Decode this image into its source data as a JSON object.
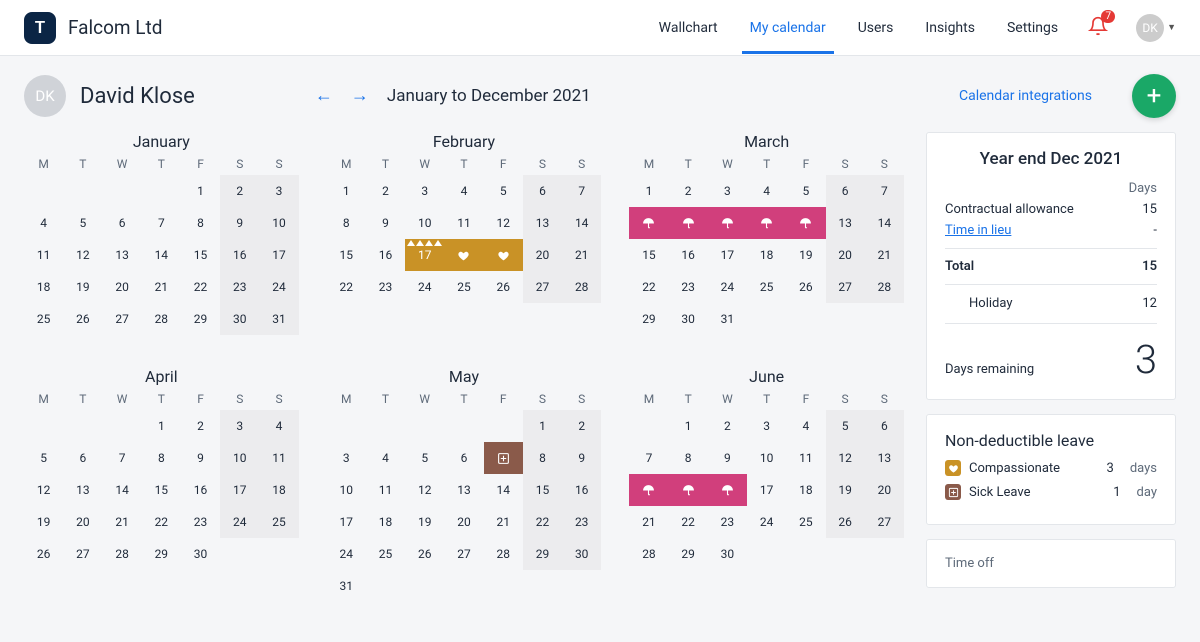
{
  "brand": {
    "logo_letter": "T",
    "name": "Falcom Ltd"
  },
  "nav": {
    "items": [
      "Wallchart",
      "My calendar",
      "Users",
      "Insights",
      "Settings"
    ],
    "active_index": 1,
    "notifications": "7",
    "user_initials": "DK"
  },
  "page": {
    "user_initials": "DK",
    "user_name": "David Klose",
    "period": "January to December 2021",
    "calendar_integrations": "Calendar integrations"
  },
  "dow": [
    "M",
    "T",
    "W",
    "T",
    "F",
    "S",
    "S"
  ],
  "side": {
    "title": "Year end Dec 2021",
    "days_label": "Days",
    "contractual_label": "Contractual allowance",
    "contractual_value": "15",
    "til_label": "Time in lieu",
    "til_value": "-",
    "total_label": "Total",
    "total_value": "15",
    "holiday_label": "Holiday",
    "holiday_value": "12",
    "remaining_label": "Days remaining",
    "remaining_value": "3",
    "nd_title": "Non-deductible leave",
    "nd_items": [
      {
        "label": "Compassionate",
        "count": "3",
        "unit": "days"
      },
      {
        "label": "Sick Leave",
        "count": "1",
        "unit": "day"
      }
    ],
    "timeoff_title": "Time off"
  },
  "icons": {
    "holiday": "umbrella-icon",
    "compassionate": "hands-icon",
    "sick": "plus-icon"
  },
  "colors": {
    "holiday": "#d13f7c",
    "compassionate": "#c99226",
    "sick": "#8a5a4a"
  },
  "months": [
    {
      "name": "January",
      "lead_blanks": 4,
      "days": 31,
      "marks": {}
    },
    {
      "name": "February",
      "lead_blanks": 0,
      "days": 28,
      "marks": {
        "17": {
          "type": "comp",
          "show": "num",
          "tri": true
        },
        "18": {
          "type": "comp",
          "show": "icon"
        },
        "19": {
          "type": "comp",
          "show": "icon"
        }
      }
    },
    {
      "name": "March",
      "lead_blanks": 0,
      "days": 31,
      "marks": {
        "8": {
          "type": "holiday",
          "show": "icon"
        },
        "9": {
          "type": "holiday",
          "show": "icon"
        },
        "10": {
          "type": "holiday",
          "show": "icon"
        },
        "11": {
          "type": "holiday",
          "show": "icon"
        },
        "12": {
          "type": "holiday",
          "show": "icon"
        }
      }
    },
    {
      "name": "April",
      "lead_blanks": 3,
      "days": 30,
      "marks": {}
    },
    {
      "name": "May",
      "lead_blanks": 5,
      "days": 31,
      "marks": {
        "7": {
          "type": "sick",
          "show": "icon"
        }
      }
    },
    {
      "name": "June",
      "lead_blanks": 1,
      "days": 30,
      "marks": {
        "14": {
          "type": "holiday",
          "show": "icon"
        },
        "15": {
          "type": "holiday",
          "show": "icon"
        },
        "16": {
          "type": "holiday",
          "show": "icon"
        }
      }
    }
  ]
}
